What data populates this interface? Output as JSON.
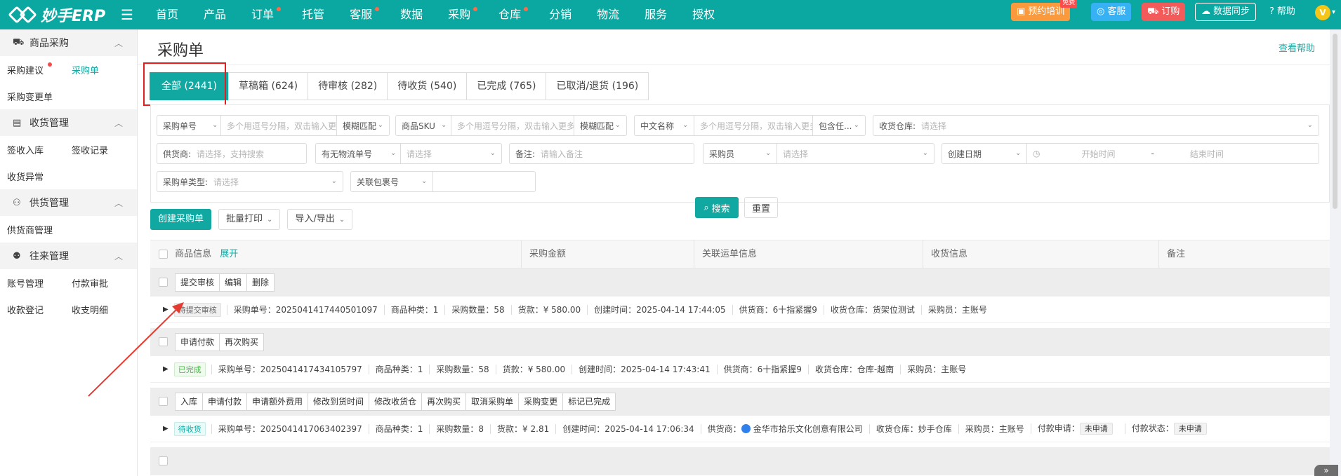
{
  "app": {
    "logo_text": "妙手ERP"
  },
  "nav": {
    "items": [
      {
        "label": "首页",
        "dot": false
      },
      {
        "label": "产品",
        "dot": false
      },
      {
        "label": "订单",
        "dot": true
      },
      {
        "label": "托管",
        "dot": false
      },
      {
        "label": "客服",
        "dot": true
      },
      {
        "label": "数据",
        "dot": false
      },
      {
        "label": "采购",
        "dot": true
      },
      {
        "label": "仓库",
        "dot": true
      },
      {
        "label": "分销",
        "dot": false
      },
      {
        "label": "物流",
        "dot": false
      },
      {
        "label": "服务",
        "dot": false
      },
      {
        "label": "授权",
        "dot": false
      }
    ]
  },
  "topright": {
    "training": "预约培训",
    "training_tag": "免费",
    "service": "客服",
    "order": "订购",
    "sync": "数据同步",
    "help": "帮助",
    "avatar_letter": "V"
  },
  "sidebar": {
    "groups": [
      {
        "title": "商品采购",
        "icon": "cart-icon",
        "rows": [
          [
            "采购建议",
            "采购单"
          ],
          [
            "采购变更单"
          ]
        ]
      },
      {
        "title": "收货管理",
        "icon": "clipboard-icon",
        "rows": [
          [
            "签收入库",
            "签收记录"
          ],
          [
            "收货异常"
          ]
        ]
      },
      {
        "title": "供货管理",
        "icon": "supplier-icon",
        "rows": [
          [
            "供货商管理"
          ]
        ]
      },
      {
        "title": "往来管理",
        "icon": "user-icon",
        "rows": [
          [
            "账号管理",
            "付款审批"
          ],
          [
            "收款登记",
            "收支明细"
          ]
        ]
      }
    ]
  },
  "page": {
    "title": "采购单",
    "help_link": "查看帮助"
  },
  "tabs": [
    {
      "label": "全部 (2441)",
      "active": true
    },
    {
      "label": "草稿箱 (624)",
      "active": false
    },
    {
      "label": "待审核 (282)",
      "active": false
    },
    {
      "label": "待收货 (540)",
      "active": false
    },
    {
      "label": "已完成 (765)",
      "active": false
    },
    {
      "label": "已取消/退货 (196)",
      "active": false
    }
  ],
  "filters": {
    "po_no_select": "采购单号",
    "multi_placeholder": "多个用逗号分隔，双击输入更多",
    "fuzzy": "模糊匹配",
    "sku_select": "商品SKU",
    "cn_name_select": "中文名称",
    "contains": "包含任...",
    "warehouse_label": "收货仓库:",
    "please_select": "请选择",
    "supplier_label": "供货商:",
    "supplier_placeholder": "请选择，支持搜索",
    "tracking_select": "有无物流单号",
    "remark_label": "备注:",
    "remark_placeholder": "请输入备注",
    "buyer_select": "采购员",
    "date_select": "创建日期",
    "start_time": "开始时间",
    "dash": "-",
    "end_time": "结束时间",
    "type_label": "采购单类型:",
    "package_select": "关联包裹号",
    "search": "搜索",
    "reset": "重置"
  },
  "actions": {
    "create": "创建采购单",
    "batch_print": "批量打印",
    "import_export": "导入/导出"
  },
  "table": {
    "headers": {
      "product": "商品信息",
      "expand": "展开",
      "amount": "采购金额",
      "waybill": "关联运单信息",
      "receiving": "收货信息",
      "remark": "备注"
    },
    "orders": [
      {
        "ops": [
          "提交审核",
          "编辑",
          "删除"
        ],
        "status": "待提交审核",
        "status_style": "gray",
        "fields": [
          "采购单号：2025041417440501097",
          "商品种类：1",
          "采购数量：58",
          "货款：¥ 580.00",
          "创建时间：2025-04-14 17:44:05",
          "供货商：6十指紧握9",
          "收货仓库：货架位测试",
          "采购员：主账号"
        ]
      },
      {
        "ops": [
          "申请付款",
          "再次购买"
        ],
        "status": "已完成",
        "status_style": "green",
        "fields": [
          "采购单号：2025041417434105797",
          "商品种类：1",
          "采购数量：58",
          "货款：¥ 580.00",
          "创建时间：2025-04-14 17:43:41",
          "供货商：6十指紧握9",
          "收货仓库：仓库-越南",
          "采购员：主账号"
        ]
      },
      {
        "ops": [
          "入库",
          "申请付款",
          "申请额外费用",
          "修改到货时间",
          "修改收货仓",
          "再次购买",
          "取消采购单",
          "采购变更",
          "标记已完成"
        ],
        "status": "待收货",
        "status_style": "teal",
        "fields": [
          "采购单号：2025041417063402397",
          "商品种类：1",
          "采购数量：8",
          "货款：¥ 2.81",
          "创建时间：2025-04-14 17:06:34"
        ],
        "supplier_label": "供货商：",
        "supplier_name": "金华市拾乐文化创意有限公司",
        "fields_after": [
          "收货仓库：妙手仓库",
          "采购员：主账号"
        ],
        "pay_apply_label": "付款申请：",
        "pay_apply_value": "未申请",
        "pay_status_label": "付款状态：",
        "pay_status_value": "未申请"
      }
    ]
  },
  "corner": "»"
}
